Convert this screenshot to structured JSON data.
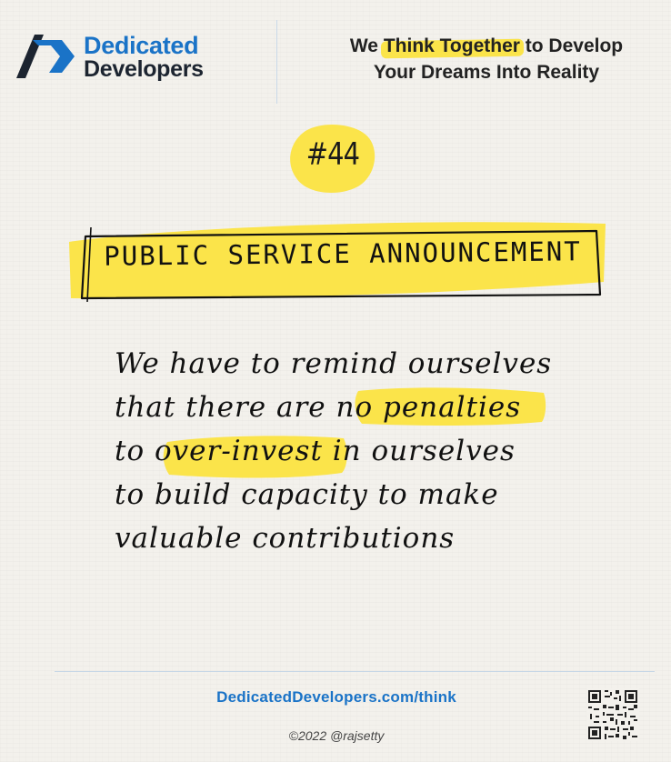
{
  "header": {
    "logo": {
      "line1": "Dedicated",
      "line2": "Developers"
    },
    "tagline": {
      "prefix": "We ",
      "highlight": "Think Together",
      "suffix": " to Develop",
      "line2": "Your Dreams Into Reality"
    }
  },
  "issue": {
    "label": "#44"
  },
  "banner": {
    "text": "PUBLIC SERVICE ANNOUNCEMENT"
  },
  "message": {
    "lines": [
      "We have to remind ourselves",
      "that there are no penalties",
      "to over-invest in ourselves",
      "to build capacity to make",
      "valuable contributions"
    ]
  },
  "footer": {
    "url": "DedicatedDevelopers.com/think",
    "copyright": "©2022 @rajsetty"
  },
  "colors": {
    "brand_blue": "#1a73c7",
    "highlight_yellow": "#fbe44a",
    "dark": "#1c2430"
  },
  "icons": {
    "logo": "dedicated-developers-logo-icon",
    "qr": "qr-code-icon"
  }
}
